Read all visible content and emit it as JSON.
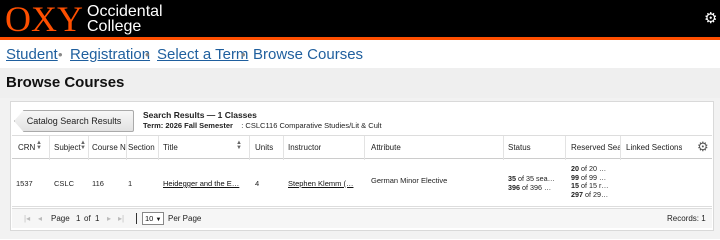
{
  "header": {
    "logo_text": "OXY",
    "college_line1": "Occidental",
    "college_line2": "College",
    "settings_icon": "gear-icon",
    "accent_color": "#ff4f00"
  },
  "breadcrumb": {
    "items": [
      "Student",
      "Registration",
      "Select a Term",
      "Browse Courses"
    ]
  },
  "page": {
    "title": "Browse Courses"
  },
  "results": {
    "back_button": "Catalog Search Results",
    "title": "Search Results — 1 Classes",
    "term_label": "Term: 2026 Fall Semester",
    "term_course": ": CSLC116 Comparative Studies/Lit & Cult"
  },
  "table": {
    "columns": [
      "CRN",
      "Subject",
      "Course N",
      "Section",
      "Title",
      "Units",
      "Instructor",
      "Attribute",
      "Status",
      "Reserved Sea",
      "Linked Sections"
    ],
    "rows": [
      {
        "crn": "1537",
        "subject": "CSLC",
        "course": "116",
        "section": "1",
        "title": "Heidegger and the E…",
        "units": "4",
        "instructor": "Stephen Klemm (…",
        "attribute": "German Minor Elective",
        "status_1_num": "35",
        "status_1_rest": " of 35 sea…",
        "status_2_num": "396",
        "status_2_rest": " of 396 …",
        "res_1_num": "20",
        "res_1_rest": " of 20 …",
        "res_2_num": "99",
        "res_2_rest": " of 99 …",
        "res_3_num": "15",
        "res_3_rest": " of 15 r…",
        "res_4_num": "297",
        "res_4_rest": " of 29…",
        "linked": ""
      }
    ]
  },
  "pager": {
    "page_label": "Page",
    "page_value": "1",
    "of_label": "of",
    "page_total": "1",
    "per_page_value": "10",
    "per_page_label": "Per Page",
    "records": "Records: 1"
  }
}
